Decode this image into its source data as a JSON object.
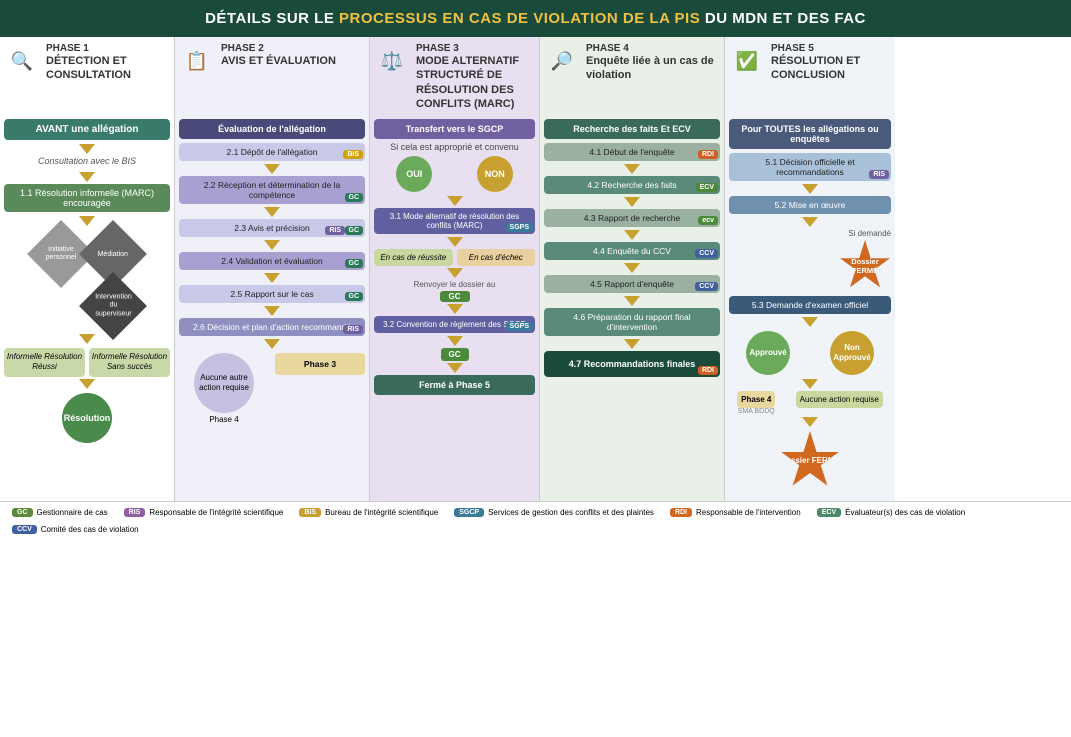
{
  "header": {
    "title_prefix": "DÉTAILS SUR LE ",
    "title_highlight1": "PROCESSUS EN CAS DE VIOLATION DE LA PIS",
    "title_suffix": " DU MDN ET DES FAC"
  },
  "phases": [
    {
      "id": "p1",
      "num": "PHASE 1",
      "title": "DÉTECTION ET CONSULTATION",
      "icon": "🔍",
      "avant": "AVANT une allégation",
      "consult": "Consultation avec le BIS",
      "resolution": "1.1 Résolution informelle (MARC) encouragée",
      "initiative": "Initiative\npersonnel",
      "mediation": "Médiation",
      "intervention": "Intervention\ndu\nsuperviseur",
      "box1": "Informelle\nRésolution\nRéussi",
      "box2": "Informelle\nRésolution\nSans succès",
      "resolution_final": "Résolution"
    },
    {
      "id": "p2",
      "num": "PHASE 2",
      "title": "AVIS ET ÉVALUATION",
      "icon": "📋",
      "eval_header": "Évaluation de l'allégation",
      "steps": [
        {
          "label": "2.1 Dépôt de l'allégation",
          "badge": "BIS",
          "badge_color": "badge-gold"
        },
        {
          "label": "2.2 Réception et détermination de la compétence",
          "badge": "GC",
          "badge_color": "badge-teal"
        },
        {
          "label": "2.3 Avis et précision",
          "badge_left": "RIS",
          "badge": "GC",
          "badge_color": "badge-teal"
        },
        {
          "label": "2.4 Validation et évaluation",
          "badge": "GC",
          "badge_color": "badge-teal"
        },
        {
          "label": "2.5 Rapport sur le cas",
          "badge": "GC",
          "badge_color": "badge-teal"
        },
        {
          "label": "2.6 Décision et plan d'action recommandé",
          "badge": "RIS",
          "badge_color": "badge-purple"
        }
      ],
      "no_action": "Aucune\nautre\naction\nrequise",
      "phase3_link": "Phase 3",
      "phase4_link": "Phase 4"
    },
    {
      "id": "p3",
      "num": "PHASE 3",
      "title": "MODE ALTERNATIF STRUCTURÉ DE RÉSOLUTION DES CONFLITS (MARC)",
      "icon": "⚖️",
      "transfer_header": "Transfert vers le SGCP",
      "si_text": "Si cela est approprié et convenu",
      "oui": "OUI",
      "non": "NON",
      "marc_step": "3.1 Mode alternatif de résolution des conflits (MARC)",
      "marc_badge": "SGPS",
      "en_cas_reussite": "En cas de\nréussite",
      "en_cas_echec": "En cas\nd'échec",
      "renvoyer": "Renvoyer le\ndossier au",
      "gc_badge": "GC",
      "convention": "3.2 Convention de règlement des SGCP",
      "conv_badge": "SGPS",
      "gc_label": "GC",
      "ferme_phase5": "Fermé à\nPhase 5"
    },
    {
      "id": "p4",
      "num": "PHASE 4",
      "title": "Enquête liée à un cas de violation",
      "icon": "🔎",
      "recherche_header": "Recherche des faits Et ECV",
      "steps": [
        {
          "label": "4.1 Début de l'enquête",
          "badge": "RDI",
          "badge_color": "badge-orange"
        },
        {
          "label": "4.2 Recherche des faits",
          "badge": "ECV",
          "badge_color": "badge-green"
        },
        {
          "label": "4.3 Rapport de recherche",
          "badge": "ecv",
          "badge_color": "badge-green"
        },
        {
          "label": "4.4 Enquête du CCV",
          "badge": "CCV",
          "badge_color": "badge-blue"
        },
        {
          "label": "4.5 Rapport d'enquête",
          "badge": "CCV",
          "badge_color": "badge-blue"
        },
        {
          "label": "4.6 Préparation du rapport final d'intervention",
          "badge": "",
          "badge_color": ""
        }
      ],
      "recommandations": "4.7 Recommandations finales",
      "rdi_badge": "RDI"
    },
    {
      "id": "p5",
      "num": "PHASE 5",
      "title": "RÉSOLUTION ET CONCLUSION",
      "icon": "✅",
      "pour_toutes": "Pour TOUTES les allégations ou enquêtes",
      "steps": [
        {
          "label": "5.1 Décision officielle et recommandations",
          "badge": "RIS",
          "badge_color": "badge-purple"
        },
        {
          "label": "5.2 Mise en œuvre",
          "badge": "",
          "badge_color": ""
        },
        {
          "label": "5.3 Demande d'examen officiel",
          "badge": "",
          "badge_color": ""
        }
      ],
      "si_demande": "Si demandé",
      "dossier_ferme": "Dossier\nFERMÉ",
      "approuve": "Approuvé",
      "non_approuve": "Non\nApprouvé",
      "phase4_label": "Phase 4",
      "sma_label": "SMA\nBDDQ",
      "aucune": "Aucune action\nrequise",
      "dossier_ferme2": "Dossier\nFERMÉ"
    }
  ],
  "legend": [
    {
      "badge": "GC",
      "color": "leg-gc",
      "label": "Gestionnaire de cas"
    },
    {
      "badge": "RIS",
      "color": "leg-ris",
      "label": "Responsable de l'intégrité scientifique"
    },
    {
      "badge": "BIS",
      "color": "leg-bis",
      "label": "Bureau de l'intégrité scientifique"
    },
    {
      "badge": "SGCP",
      "color": "leg-sgcp",
      "label": "Services de gestion des conflits et des plaintes"
    },
    {
      "badge": "RDI",
      "color": "leg-rdi",
      "label": "Responsable de l'intervention"
    },
    {
      "badge": "ECV",
      "color": "leg-ecv",
      "label": "Évaluateur(s) des cas de violation"
    },
    {
      "badge": "CCV",
      "color": "leg-ccv",
      "label": "Comité des cas de violation"
    }
  ]
}
